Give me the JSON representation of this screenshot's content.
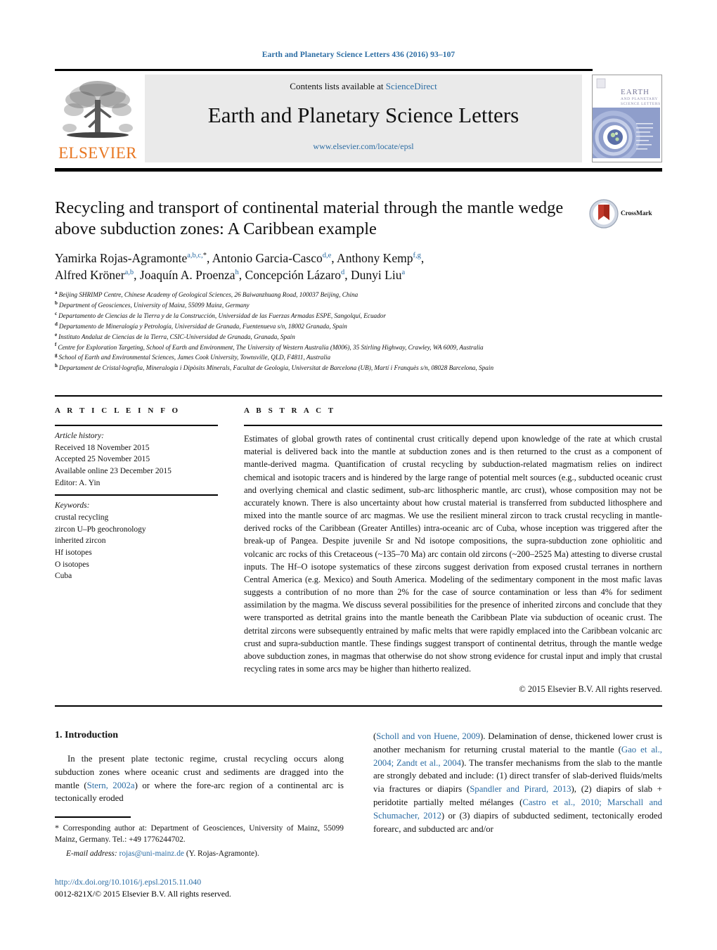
{
  "running_head": "Earth and Planetary Science Letters 436 (2016) 93–107",
  "masthead": {
    "contents_prefix": "Contents lists available at ",
    "sciencedirect": "ScienceDirect",
    "journal_title": "Earth and Planetary Science Letters",
    "journal_url": "www.elsevier.com/locate/epsl",
    "publisher": "ELSEVIER",
    "cover_title_line1": "EARTH",
    "cover_title_line2": "AND PLANETARY",
    "cover_title_line3": "SCIENCE LETTERS"
  },
  "article": {
    "title": "Recycling and transport of continental material through the mantle wedge above subduction zones: A Caribbean example",
    "crossmark_label": "CrossMark",
    "authors_line1": "Yamirka Rojas-Agramonte a,b,c,*, Antonio Garcia-Casco d,e, Anthony Kemp f,g,",
    "authors_line2": "Alfred Kröner a,b, Joaquín A. Proenza h, Concepción Lázaro d, Dunyi Liu a",
    "affiliations": [
      {
        "mark": "a",
        "text": "Beijing SHRIMP Centre, Chinese Academy of Geological Sciences, 26 Baiwanzhuang Road, 100037 Beijing, China"
      },
      {
        "mark": "b",
        "text": "Department of Geosciences, University of Mainz, 55099 Mainz, Germany"
      },
      {
        "mark": "c",
        "text": "Departamento de Ciencias de la Tierra y de la Construcción, Universidad de las Fuerzas Armadas ESPE, Sangolquí, Ecuador"
      },
      {
        "mark": "d",
        "text": "Departamento de Mineralogía y Petrología, Universidad de Granada, Fuentenueva s/n, 18002 Granada, Spain"
      },
      {
        "mark": "e",
        "text": "Instituto Andaluz de Ciencias de la Tierra, CSIC-Universidad de Granada, Granada, Spain"
      },
      {
        "mark": "f",
        "text": "Centre for Exploration Targeting, School of Earth and Environment, The University of Western Australia (M006), 35 Stirling Highway, Crawley, WA 6009, Australia"
      },
      {
        "mark": "g",
        "text": "School of Earth and Environmental Sciences, James Cook University, Townsville, QLD, F4811, Australia"
      },
      {
        "mark": "h",
        "text": "Departament de Cristal·lografia, Mineralogia i Dipòsits Minerals, Facultat de Geologia, Universitat de Barcelona (UB), Martí i Franquès s/n, 08028 Barcelona, Spain"
      }
    ]
  },
  "headers": {
    "article_info": "A R T I C L E   I N F O",
    "abstract": "A B S T R A C T"
  },
  "article_info": {
    "history_label": "Article history:",
    "history": [
      "Received 18 November 2015",
      "Accepted 25 November 2015",
      "Available online 23 December 2015",
      "Editor: A. Yin"
    ],
    "keywords_label": "Keywords:",
    "keywords": [
      "crustal recycling",
      "zircon U–Pb geochronology",
      "inherited zircon",
      "Hf isotopes",
      "O isotopes",
      "Cuba"
    ]
  },
  "abstract": {
    "text": "Estimates of global growth rates of continental crust critically depend upon knowledge of the rate at which crustal material is delivered back into the mantle at subduction zones and is then returned to the crust as a component of mantle-derived magma. Quantification of crustal recycling by subduction-related magmatism relies on indirect chemical and isotopic tracers and is hindered by the large range of potential melt sources (e.g., subducted oceanic crust and overlying chemical and clastic sediment, sub-arc lithospheric mantle, arc crust), whose composition may not be accurately known. There is also uncertainty about how crustal material is transferred from subducted lithosphere and mixed into the mantle source of arc magmas. We use the resilient mineral zircon to track crustal recycling in mantle-derived rocks of the Caribbean (Greater Antilles) intra-oceanic arc of Cuba, whose inception was triggered after the break-up of Pangea. Despite juvenile Sr and Nd isotope compositions, the supra-subduction zone ophiolitic and volcanic arc rocks of this Cretaceous (~135–70 Ma) arc contain old zircons (~200–2525 Ma) attesting to diverse crustal inputs. The Hf–O isotope systematics of these zircons suggest derivation from exposed crustal terranes in northern Central America (e.g. Mexico) and South America. Modeling of the sedimentary component in the most mafic lavas suggests a contribution of no more than 2% for the case of source contamination or less than 4% for sediment assimilation by the magma. We discuss several possibilities for the presence of inherited zircons and conclude that they were transported as detrital grains into the mantle beneath the Caribbean Plate via subduction of oceanic crust. The detrital zircons were subsequently entrained by mafic melts that were rapidly emplaced into the Caribbean volcanic arc crust and supra-subduction mantle. These findings suggest transport of continental detritus, through the mantle wedge above subduction zones, in magmas that otherwise do not show strong evidence for crustal input and imply that crustal recycling rates in some arcs may be higher than hitherto realized.",
    "copyright": "© 2015 Elsevier B.V. All rights reserved."
  },
  "body": {
    "section_heading": "1. Introduction",
    "left_para_1": "In the present plate tectonic regime, crustal recycling occurs along subduction zones where oceanic crust and sediments are dragged into the mantle (",
    "left_ref_1": "Stern, 2002a",
    "left_para_1b": ") or where the fore-arc region of a continental arc is tectonically eroded",
    "right_ref_1": "Scholl and von Huene, 2009",
    "right_para_1": "). Delamination of dense, thickened lower crust is another mechanism for returning crustal material to the mantle (",
    "right_ref_2": "Gao et al., 2004; Zandt et al., 2004",
    "right_para_2": "). The transfer mechanisms from the slab to the mantle are strongly debated and include: (1) direct transfer of slab-derived fluids/melts via fractures or diapirs (",
    "right_ref_3": "Spandler and Pirard, 2013",
    "right_para_3": "), (2) diapirs of slab + peridotite partially melted mélanges (",
    "right_ref_4": "Castro et al., 2010; Marschall and Schumacher, 2012",
    "right_para_4": ") or (3) diapirs of subducted sediment, tectonically eroded forearc, and subducted arc and/or"
  },
  "footnote": {
    "star": "*",
    "corresponding": "Corresponding author at: Department of Geosciences, University of Mainz, 55099 Mainz, Germany. Tel.: +49 1776244702.",
    "email_label": "E-mail address:",
    "email": "rojas@uni-mainz.de",
    "email_suffix": "(Y. Rojas-Agramonte).",
    "doi": "http://dx.doi.org/10.1016/j.epsl.2015.11.040",
    "issn_line": "0012-821X/© 2015 Elsevier B.V. All rights reserved."
  },
  "colors": {
    "link": "#2b6ca3",
    "elsevier_orange": "#E87722"
  }
}
